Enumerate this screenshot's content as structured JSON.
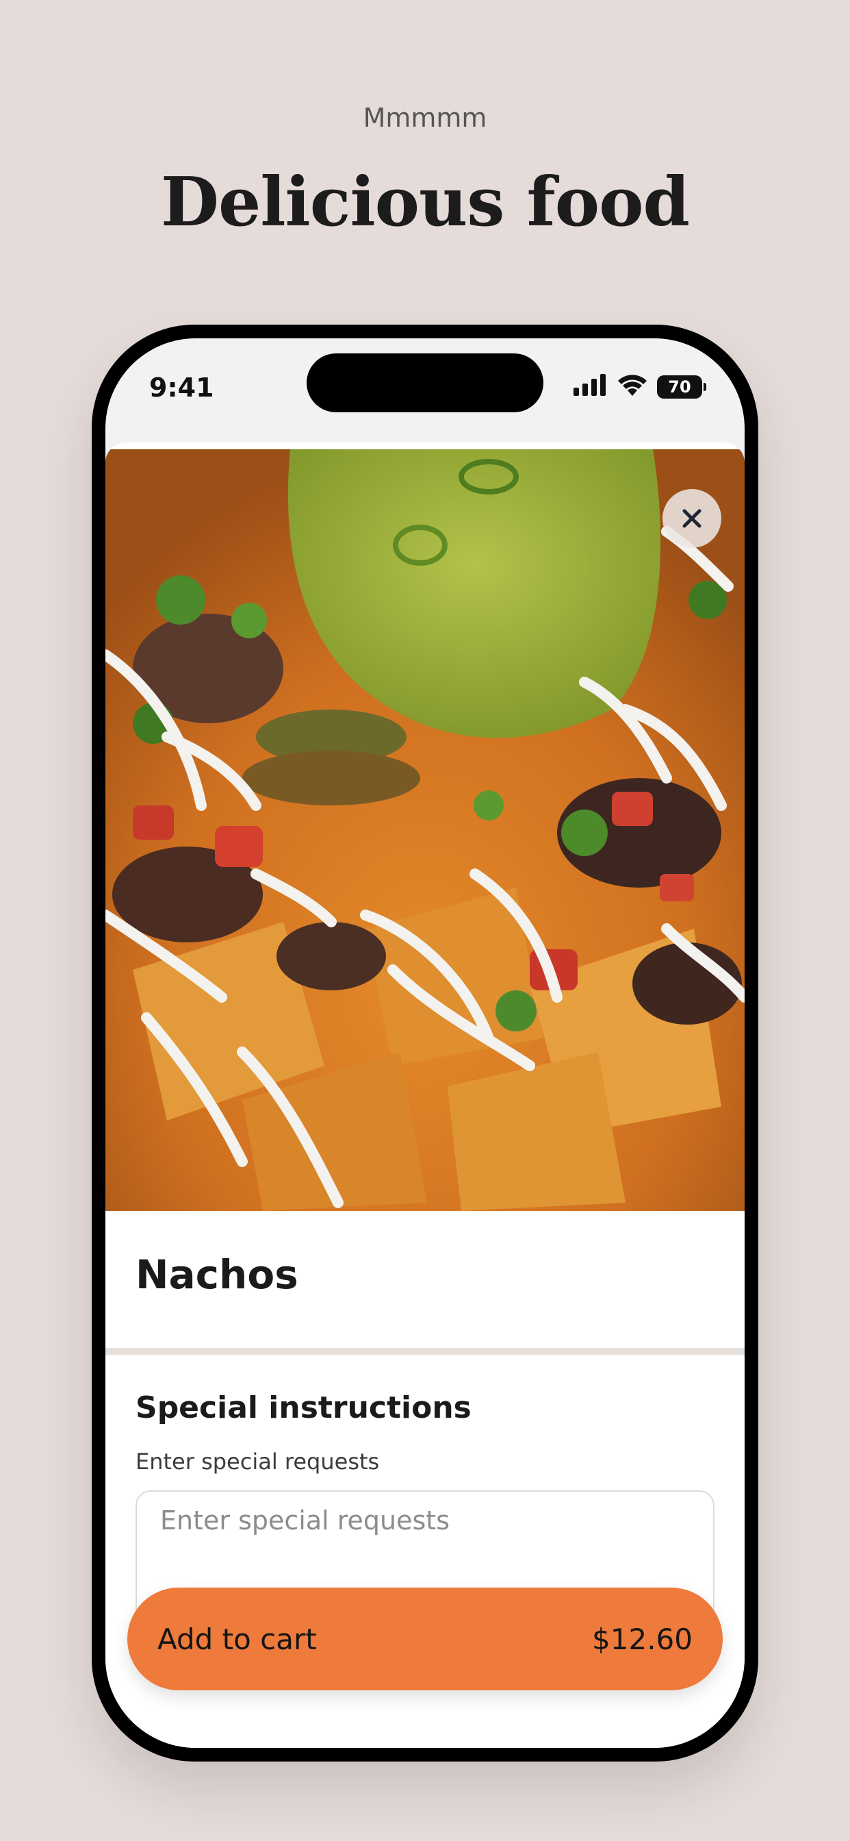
{
  "header": {
    "eyebrow": "Mmmmm",
    "headline": "Delicious food"
  },
  "status_bar": {
    "time": "9:41",
    "battery": "70",
    "icons": [
      "signal-icon",
      "wifi-icon",
      "battery-icon"
    ]
  },
  "item": {
    "image_alt": "Nachos with guacamole, pico de gallo and sour cream",
    "name": "Nachos"
  },
  "special_instructions": {
    "title": "Special instructions",
    "subtitle": "Enter special requests",
    "placeholder": "Enter special requests",
    "value": ""
  },
  "cart": {
    "label": "Add to cart",
    "price": "$12.60"
  },
  "colors": {
    "background": "#e5dcd9",
    "accent": "#ee7a3c"
  }
}
